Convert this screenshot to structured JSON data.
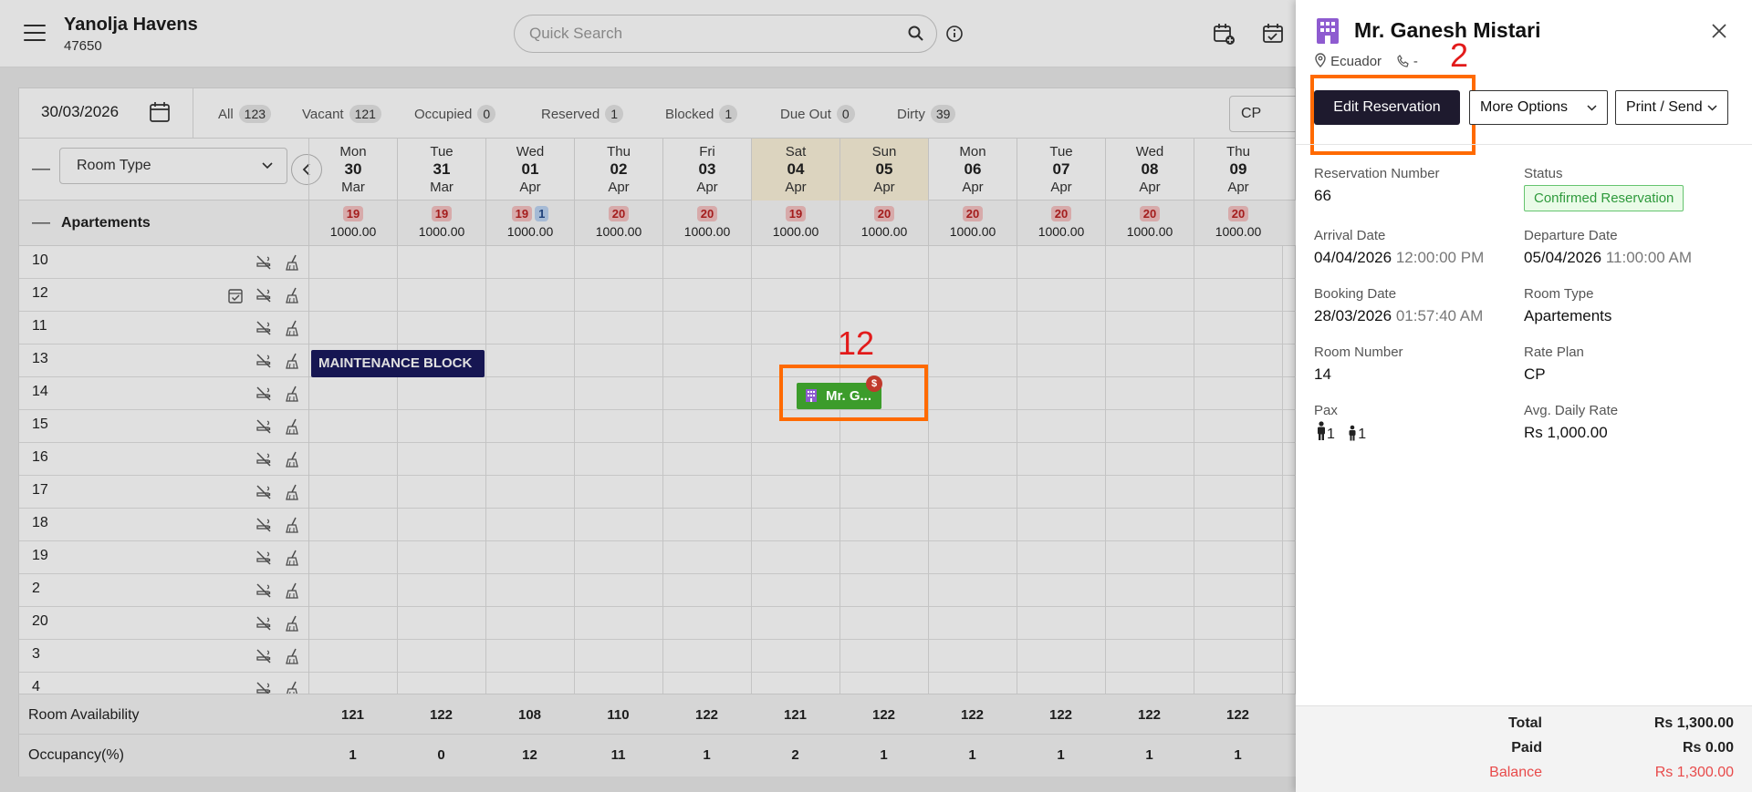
{
  "app": {
    "hotel_name": "Yanolja Havens",
    "hotel_code": "47650",
    "search_placeholder": "Quick Search"
  },
  "filters": {
    "date": "30/03/2026",
    "stats": [
      {
        "label": "All",
        "count": "123"
      },
      {
        "label": "Vacant",
        "count": "121"
      },
      {
        "label": "Occupied",
        "count": "0"
      },
      {
        "label": "Reserved",
        "count": "1"
      },
      {
        "label": "Blocked",
        "count": "1"
      },
      {
        "label": "Due Out",
        "count": "0"
      },
      {
        "label": "Dirty",
        "count": "39"
      }
    ],
    "rate_plan": "CP",
    "room_type_select": "Room Type"
  },
  "days": [
    {
      "name": "Mon",
      "date": "30",
      "month": "Mar",
      "weekend": false
    },
    {
      "name": "Tue",
      "date": "31",
      "month": "Mar",
      "weekend": false
    },
    {
      "name": "Wed",
      "date": "01",
      "month": "Apr",
      "weekend": false
    },
    {
      "name": "Thu",
      "date": "02",
      "month": "Apr",
      "weekend": false
    },
    {
      "name": "Fri",
      "date": "03",
      "month": "Apr",
      "weekend": false
    },
    {
      "name": "Sat",
      "date": "04",
      "month": "Apr",
      "weekend": true
    },
    {
      "name": "Sun",
      "date": "05",
      "month": "Apr",
      "weekend": true
    },
    {
      "name": "Mon",
      "date": "06",
      "month": "Apr",
      "weekend": false
    },
    {
      "name": "Tue",
      "date": "07",
      "month": "Apr",
      "weekend": false
    },
    {
      "name": "Wed",
      "date": "08",
      "month": "Apr",
      "weekend": false
    },
    {
      "name": "Thu",
      "date": "09",
      "month": "Apr",
      "weekend": false
    }
  ],
  "group": {
    "name": "Apartements",
    "cells": [
      {
        "avail": "19",
        "extra": "",
        "rate": "1000.00"
      },
      {
        "avail": "19",
        "extra": "",
        "rate": "1000.00"
      },
      {
        "avail": "19",
        "extra": "1",
        "rate": "1000.00"
      },
      {
        "avail": "20",
        "extra": "",
        "rate": "1000.00"
      },
      {
        "avail": "20",
        "extra": "",
        "rate": "1000.00"
      },
      {
        "avail": "19",
        "extra": "",
        "rate": "1000.00"
      },
      {
        "avail": "20",
        "extra": "",
        "rate": "1000.00"
      },
      {
        "avail": "20",
        "extra": "",
        "rate": "1000.00"
      },
      {
        "avail": "20",
        "extra": "",
        "rate": "1000.00"
      },
      {
        "avail": "20",
        "extra": "",
        "rate": "1000.00"
      },
      {
        "avail": "20",
        "extra": "",
        "rate": "1000.00"
      }
    ]
  },
  "rooms": [
    {
      "number": "10",
      "checked": false
    },
    {
      "number": "12",
      "checked": true
    },
    {
      "number": "11",
      "checked": false
    },
    {
      "number": "13",
      "checked": false
    },
    {
      "number": "14",
      "checked": false
    },
    {
      "number": "15",
      "checked": false
    },
    {
      "number": "16",
      "checked": false
    },
    {
      "number": "17",
      "checked": false
    },
    {
      "number": "18",
      "checked": false
    },
    {
      "number": "19",
      "checked": false
    },
    {
      "number": "2",
      "checked": false
    },
    {
      "number": "20",
      "checked": false
    },
    {
      "number": "3",
      "checked": false
    },
    {
      "number": "4",
      "checked": false
    }
  ],
  "maintenance_label": "MAINTENANCE BLOCK",
  "reservation_chip": {
    "label": "Mr. G...",
    "badge": "$"
  },
  "annotations": {
    "chip": "12",
    "edit": "2"
  },
  "footer": {
    "availability_label": "Room Availability",
    "availability": [
      "121",
      "122",
      "108",
      "110",
      "122",
      "121",
      "122",
      "122",
      "122",
      "122",
      "122"
    ],
    "occupancy_label": "Occupancy(%)",
    "occupancy": [
      "1",
      "0",
      "12",
      "11",
      "1",
      "2",
      "1",
      "1",
      "1",
      "1",
      "1"
    ]
  },
  "drawer": {
    "guest_name": "Mr. Ganesh Mistari",
    "country": "Ecuador",
    "phone": "-",
    "buttons": {
      "edit": "Edit Reservation",
      "more": "More Options",
      "print": "Print / Send"
    },
    "fields": {
      "reservation_number_label": "Reservation Number",
      "reservation_number": "66",
      "status_label": "Status",
      "status": "Confirmed Reservation",
      "arrival_label": "Arrival Date",
      "arrival_date": "04/04/2026",
      "arrival_time": "12:00:00 PM",
      "departure_label": "Departure Date",
      "departure_date": "05/04/2026",
      "departure_time": "11:00:00 AM",
      "booking_label": "Booking Date",
      "booking_date": "28/03/2026",
      "booking_time": "01:57:40 AM",
      "room_type_label": "Room Type",
      "room_type": "Apartements",
      "room_number_label": "Room Number",
      "room_number": "14",
      "rate_plan_label": "Rate Plan",
      "rate_plan": "CP",
      "pax_label": "Pax",
      "adults": "1",
      "children": "1",
      "adr_label": "Avg. Daily Rate",
      "adr": "Rs 1,000.00"
    },
    "totals": {
      "total_label": "Total",
      "total": "Rs 1,300.00",
      "paid_label": "Paid",
      "paid": "Rs 0.00",
      "balance_label": "Balance",
      "balance": "Rs 1,300.00"
    }
  },
  "colors": {
    "highlight": "#ff6a00",
    "annotation": "#e21a1a",
    "chip": "#3c9c2b",
    "maintenance": "#1a1a5e",
    "edit_button": "#1e1a2e"
  }
}
